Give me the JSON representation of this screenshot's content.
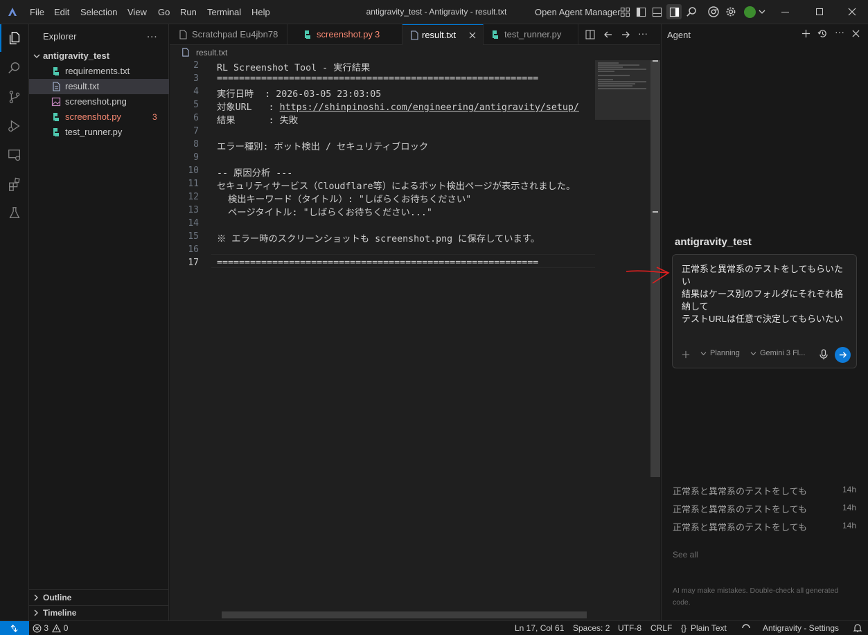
{
  "menu": [
    "File",
    "Edit",
    "Selection",
    "View",
    "Go",
    "Run",
    "Terminal",
    "Help"
  ],
  "window_title": "antigravity_test - Antigravity - result.txt",
  "open_agent_manager": "Open Agent Manager",
  "explorer": {
    "title": "Explorer",
    "more": "...",
    "root": "antigravity_test",
    "files": [
      {
        "name": "requirements.txt",
        "icon": "python-icon",
        "color": "#cccccc"
      },
      {
        "name": "result.txt",
        "icon": "text-file-icon",
        "color": "#cccccc"
      },
      {
        "name": "screenshot.png",
        "icon": "image-icon",
        "color": "#cccccc"
      },
      {
        "name": "screenshot.py",
        "icon": "python-icon",
        "color": "#f48771",
        "badge": "3"
      },
      {
        "name": "test_runner.py",
        "icon": "python-icon",
        "color": "#cccccc"
      }
    ],
    "outline": "Outline",
    "timeline": "Timeline"
  },
  "tabs": [
    {
      "label": "Scratchpad Eu4jbn78"
    },
    {
      "label": "screenshot.py",
      "badge": "3"
    },
    {
      "label": "result.txt"
    },
    {
      "label": "test_runner.py"
    }
  ],
  "breadcrumb": "result.txt",
  "code_lines": [
    {
      "n": "2",
      "t": "RL Screenshot Tool - 実行結果"
    },
    {
      "n": "3",
      "t": "=========================================================="
    },
    {
      "n": "4",
      "t": "実行日時  : 2026-03-05 23:03:05"
    },
    {
      "n": "5",
      "t": "対象URL   : https://shinpinoshi.com/engineering/antigravity/setup/"
    },
    {
      "n": "6",
      "t": "結果      : 失敗"
    },
    {
      "n": "7",
      "t": ""
    },
    {
      "n": "8",
      "t": "エラー種別: ボット検出 / セキュリティブロック"
    },
    {
      "n": "9",
      "t": ""
    },
    {
      "n": "10",
      "t": "-- 原因分析 ---"
    },
    {
      "n": "11",
      "t": "セキュリティサービス（Cloudflare等）によるボット検出ページが表示されました。"
    },
    {
      "n": "12",
      "t": "  検出キーワード（タイトル）: \"しばらくお待ちください\""
    },
    {
      "n": "13",
      "t": "  ページタイトル: \"しばらくお待ちください...\""
    },
    {
      "n": "14",
      "t": ""
    },
    {
      "n": "15",
      "t": "※ エラー時のスクリーンショットも screenshot.png に保存しています。"
    },
    {
      "n": "16",
      "t": ""
    },
    {
      "n": "17",
      "t": "=========================================================="
    }
  ],
  "agent": {
    "title": "Agent",
    "workspace": "antigravity_test",
    "prompt_lines": [
      "正常系と異常系のテストをしてもらいた",
      "い",
      "結果はケース別のフォルダにそれぞれ格",
      "納して",
      "テストURLは任意で決定してもらいたい"
    ],
    "mode": "Planning",
    "model": "Gemini 3 Fl...",
    "history": [
      {
        "text": "正常系と異常系のテストをしても",
        "age": "14h"
      },
      {
        "text": "正常系と異常系のテストをしても",
        "age": "14h"
      },
      {
        "text": "正常系と異常系のテストをしても",
        "age": "14h"
      }
    ],
    "see_all": "See all",
    "disclaimer_lines": [
      "AI may make mistakes. Double-check all generated",
      "code."
    ]
  },
  "status": {
    "errors": "3",
    "warnings": "0",
    "position": "Ln 17, Col 61",
    "spaces": "Spaces: 2",
    "encoding": "UTF-8",
    "eol": "CRLF",
    "language": "Plain Text",
    "settings": "Antigravity - Settings"
  },
  "colors": {
    "accent": "#0078d4",
    "error": "#f48771",
    "python": "#4ec9b0",
    "send": "#0e7ad7",
    "arrow": "#e02020"
  }
}
